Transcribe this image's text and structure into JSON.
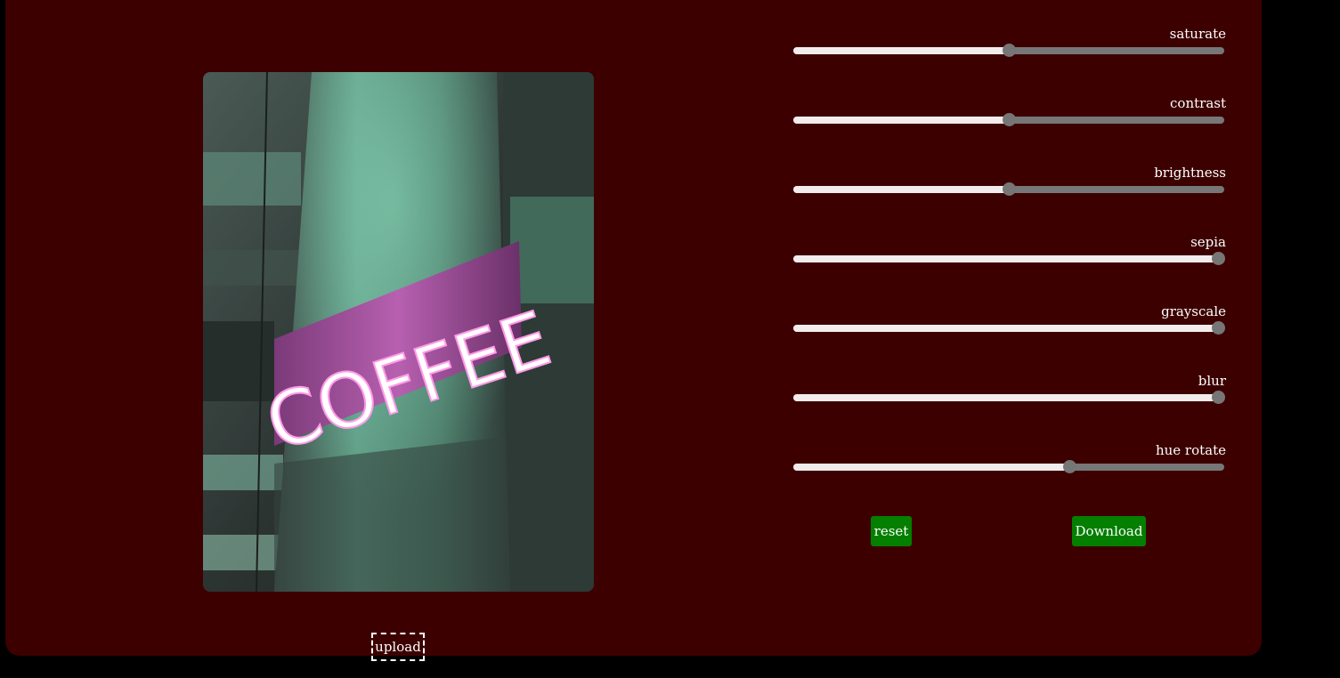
{
  "upload": {
    "label": "upload"
  },
  "photo": {
    "description": "neon COFFEE sign on concrete pillar",
    "sign_text": "COFFEE"
  },
  "controls": [
    {
      "name": "saturate",
      "label": "saturate",
      "value_fraction": 0.5
    },
    {
      "name": "contrast",
      "label": "contrast",
      "value_fraction": 0.5
    },
    {
      "name": "brightness",
      "label": "brightness",
      "value_fraction": 0.5
    },
    {
      "name": "sepia",
      "label": "sepia",
      "value_fraction": 1.0
    },
    {
      "name": "grayscale",
      "label": "grayscale",
      "value_fraction": 1.0
    },
    {
      "name": "blur",
      "label": "blur",
      "value_fraction": 1.0
    },
    {
      "name": "hue-rotate",
      "label": "hue rotate",
      "value_fraction": 0.645
    }
  ],
  "buttons": {
    "reset": "reset",
    "download": "Download"
  },
  "colors": {
    "panel_background": "#3d0000",
    "page_background": "#000000",
    "button_green": "#047f00",
    "slider_fill": "#f3ecec",
    "slider_track": "#777777"
  }
}
